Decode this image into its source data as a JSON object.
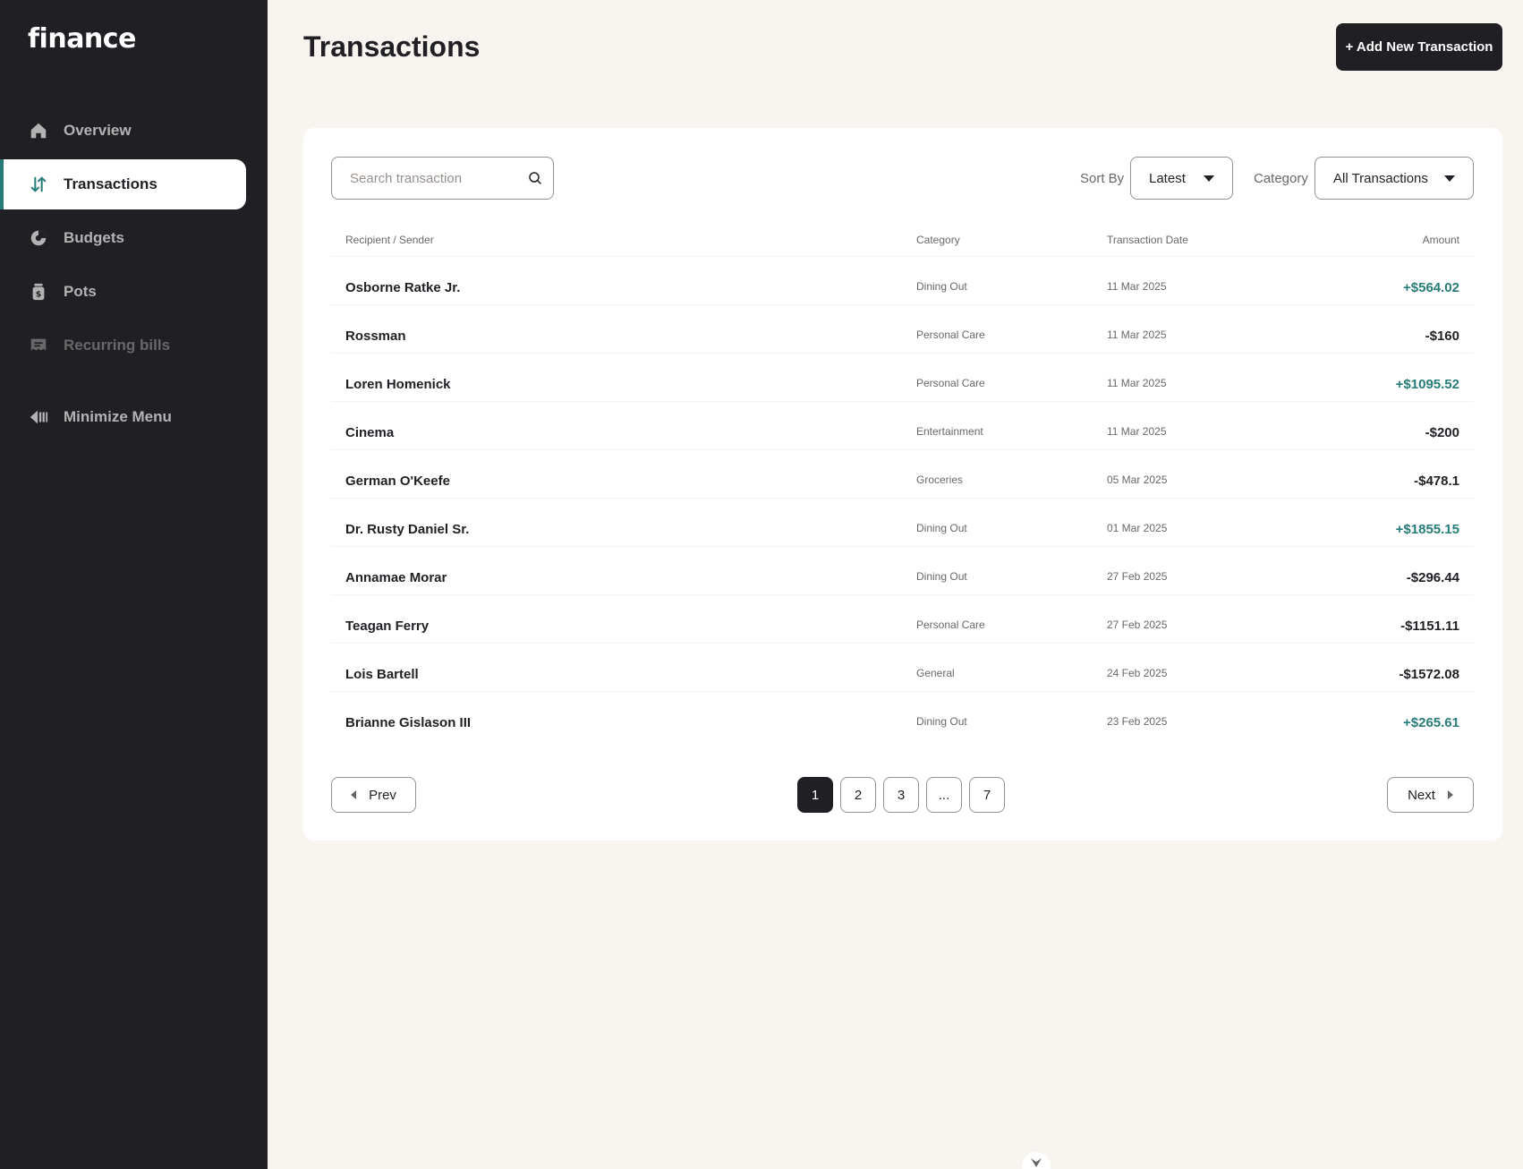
{
  "app": {
    "logo": "finance"
  },
  "sidebar": {
    "items": [
      {
        "label": "Overview",
        "icon": "home-icon"
      },
      {
        "label": "Transactions",
        "icon": "arrows-up-down-icon",
        "active": true
      },
      {
        "label": "Budgets",
        "icon": "pie-chart-icon"
      },
      {
        "label": "Pots",
        "icon": "money-jar-icon"
      },
      {
        "label": "Recurring bills",
        "icon": "receipt-icon",
        "disabled": true
      }
    ],
    "minimize": {
      "label": "Minimize Menu",
      "icon": "minimize-arrow-icon"
    }
  },
  "header": {
    "title": "Transactions",
    "add_button": "+ Add New Transaction"
  },
  "filters": {
    "search_placeholder": "Search transaction",
    "sort_label": "Sort By",
    "sort_value": "Latest",
    "category_label": "Category",
    "category_value": "All Transactions"
  },
  "table": {
    "headers": [
      "Recipient / Sender",
      "Category",
      "Transaction Date",
      "Amount"
    ],
    "rows": [
      {
        "name": "Osborne Ratke Jr.",
        "category": "Dining Out",
        "date": "11 Mar 2025",
        "amount": "+$564.02",
        "positive": true
      },
      {
        "name": "Rossman",
        "category": "Personal Care",
        "date": "11 Mar 2025",
        "amount": "-$160",
        "positive": false
      },
      {
        "name": "Loren Homenick",
        "category": "Personal Care",
        "date": "11 Mar 2025",
        "amount": "+$1095.52",
        "positive": true
      },
      {
        "name": "Cinema",
        "category": "Entertainment",
        "date": "11 Mar 2025",
        "amount": "-$200",
        "positive": false
      },
      {
        "name": "German O'Keefe",
        "category": "Groceries",
        "date": "05 Mar 2025",
        "amount": "-$478.1",
        "positive": false
      },
      {
        "name": "Dr. Rusty Daniel Sr.",
        "category": "Dining Out",
        "date": "01 Mar 2025",
        "amount": "+$1855.15",
        "positive": true
      },
      {
        "name": "Annamae Morar",
        "category": "Dining Out",
        "date": "27 Feb 2025",
        "amount": "-$296.44",
        "positive": false
      },
      {
        "name": "Teagan Ferry",
        "category": "Personal Care",
        "date": "27 Feb 2025",
        "amount": "-$1151.11",
        "positive": false
      },
      {
        "name": "Lois Bartell",
        "category": "General",
        "date": "24 Feb 2025",
        "amount": "-$1572.08",
        "positive": false
      },
      {
        "name": "Brianne Gislason III",
        "category": "Dining Out",
        "date": "23 Feb 2025",
        "amount": "+$265.61",
        "positive": true
      }
    ]
  },
  "pagination": {
    "prev": "Prev",
    "next": "Next",
    "pages": [
      "1",
      "2",
      "3",
      "...",
      "7"
    ],
    "current": "1"
  },
  "colors": {
    "sidebar_bg": "#201f24",
    "page_bg": "#f8f4f0",
    "accent_green": "#277c78",
    "text_dark": "#201f24",
    "text_grey": "#696868"
  }
}
